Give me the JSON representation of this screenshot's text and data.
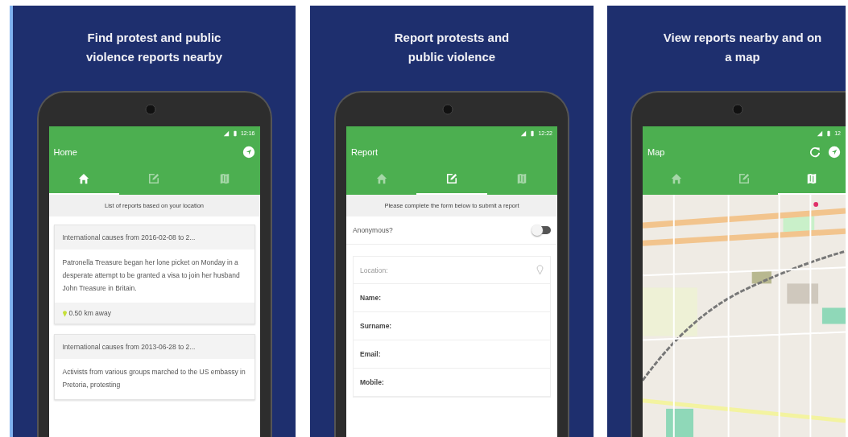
{
  "screens": [
    {
      "caption": "Find protest and public violence reports nearby",
      "status_time": "12:16",
      "title": "Home",
      "actions": [
        {
          "kind": "navigate"
        }
      ],
      "tabs": [
        {
          "kind": "home",
          "selected": true
        },
        {
          "kind": "edit",
          "selected": false
        },
        {
          "kind": "map",
          "selected": false
        }
      ],
      "kind": "list",
      "subheader": "List of reports based on your location",
      "reports": [
        {
          "title": "International causes from 2016-02-08 to 2...",
          "body": "Patronella Treasure began her lone picket on Monday in a desperate attempt to be granted a visa to join her husband John Treasure in Britain.",
          "distance": "0.50 km away"
        },
        {
          "title": "International causes from 2013-06-28 to 2...",
          "body": "Activists from various groups marched to the US embassy in Pretoria, protesting"
        }
      ]
    },
    {
      "caption": "Report protests and public violence",
      "status_time": "12:22",
      "title": "Report",
      "tabs": [
        {
          "kind": "home",
          "selected": false
        },
        {
          "kind": "edit",
          "selected": true
        },
        {
          "kind": "map",
          "selected": false
        }
      ],
      "kind": "form",
      "subheader": "Please complete the form below to submit a report",
      "anonymous": {
        "label": "Anonymous?",
        "on": false
      },
      "fields": [
        {
          "kind": "location",
          "placeholder": "Location:"
        },
        {
          "kind": "text",
          "label": "Name:"
        },
        {
          "kind": "text",
          "label": "Surname:"
        },
        {
          "kind": "text",
          "label": "Email:"
        },
        {
          "kind": "text",
          "label": "Mobile:"
        }
      ]
    },
    {
      "caption": "View reports nearby and on a map",
      "status_time": "12",
      "title": "Map",
      "actions": [
        {
          "kind": "refresh"
        },
        {
          "kind": "navigate"
        }
      ],
      "tabs": [
        {
          "kind": "home",
          "selected": false
        },
        {
          "kind": "edit",
          "selected": false
        },
        {
          "kind": "map",
          "selected": true
        }
      ],
      "kind": "map"
    }
  ]
}
